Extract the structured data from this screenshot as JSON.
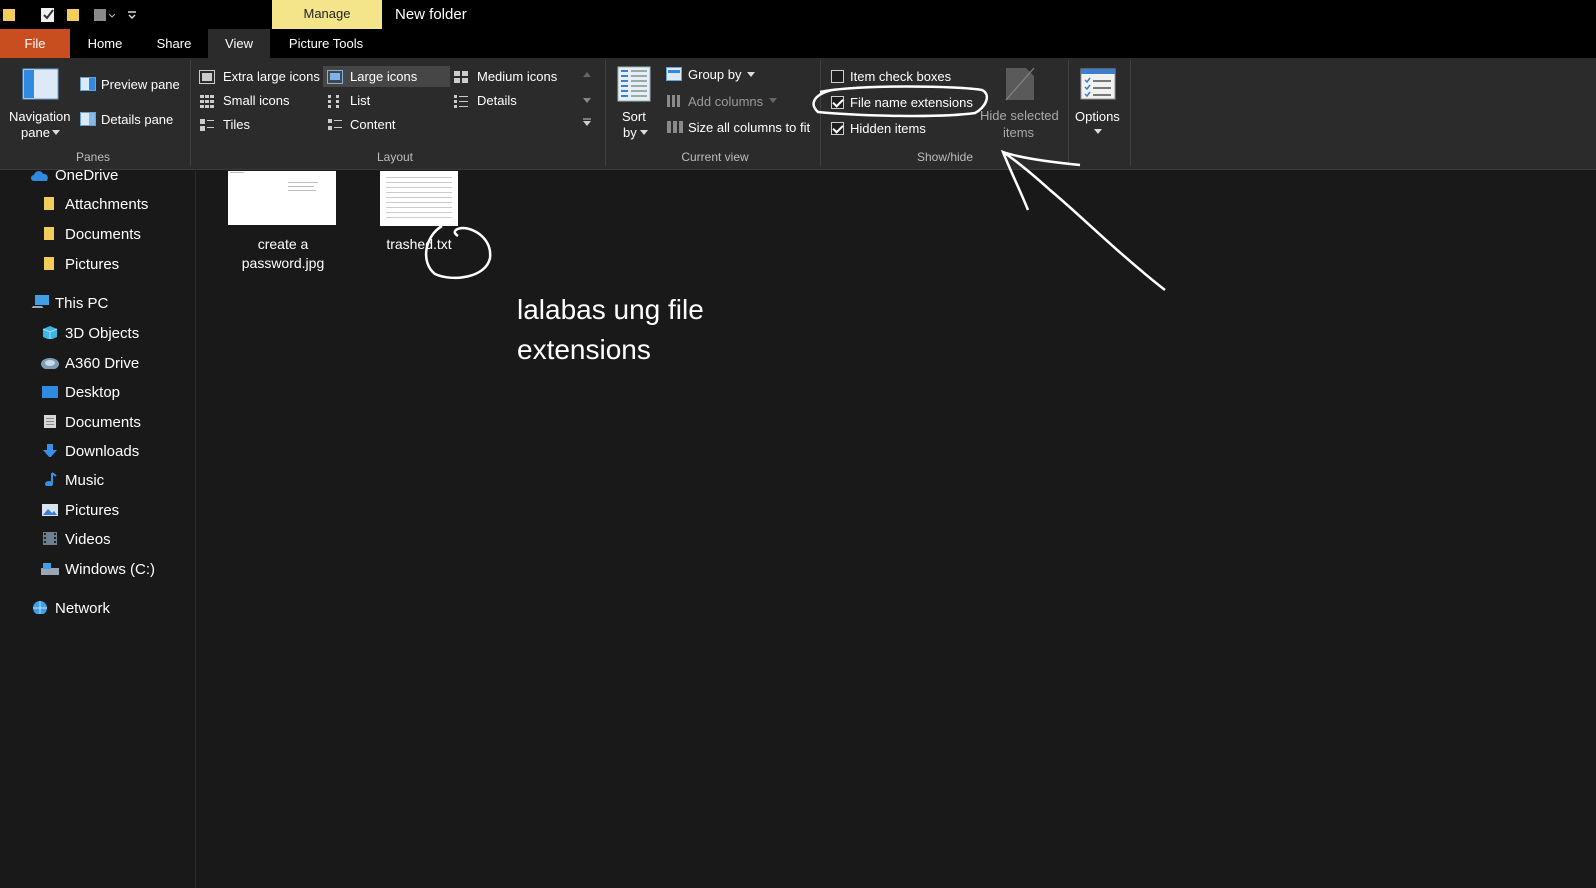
{
  "window": {
    "title": "New folder",
    "context_tab": "Manage"
  },
  "tabs": {
    "file": "File",
    "home": "Home",
    "share": "Share",
    "view": "View",
    "picture_tools": "Picture Tools"
  },
  "ribbon": {
    "panes": {
      "navigation_pane_1": "Navigation",
      "navigation_pane_2": "pane",
      "preview_pane": "Preview pane",
      "details_pane": "Details pane",
      "group_label": "Panes"
    },
    "layout": {
      "extra_large_icons": "Extra large icons",
      "large_icons": "Large icons",
      "medium_icons": "Medium icons",
      "small_icons": "Small icons",
      "list": "List",
      "details": "Details",
      "tiles": "Tiles",
      "content": "Content",
      "group_label": "Layout"
    },
    "current_view": {
      "sort_by_1": "Sort",
      "sort_by_2": "by",
      "group_by": "Group by",
      "add_columns": "Add columns",
      "size_all_columns": "Size all columns to fit",
      "group_label": "Current view"
    },
    "show_hide": {
      "item_check_boxes": "Item check boxes",
      "item_check_boxes_checked": false,
      "file_name_extensions": "File name extensions",
      "file_name_extensions_checked": true,
      "hidden_items": "Hidden items",
      "hidden_items_checked": true,
      "hide_selected_1": "Hide selected",
      "hide_selected_2": "items",
      "group_label": "Show/hide"
    },
    "options": {
      "label": "Options"
    }
  },
  "nav": {
    "onedrive": "OneDrive",
    "attachments": "Attachments",
    "documents_od": "Documents",
    "pictures_od": "Pictures",
    "this_pc": "This PC",
    "objects_3d": "3D Objects",
    "a360": "A360 Drive",
    "desktop": "Desktop",
    "documents": "Documents",
    "downloads": "Downloads",
    "music": "Music",
    "pictures": "Pictures",
    "videos": "Videos",
    "windows_c": "Windows (C:)",
    "network": "Network"
  },
  "files": {
    "file1_line1": "create a",
    "file1_line2": "password.jpg",
    "file2": "trashed.txt"
  },
  "annotation": {
    "line1": "lalabas ung file",
    "line2": "extensions"
  },
  "colors": {
    "file_tab": "#c94e1f",
    "manage_tab": "#f4e58a",
    "background": "#191919",
    "ribbon": "#2b2b2b"
  }
}
